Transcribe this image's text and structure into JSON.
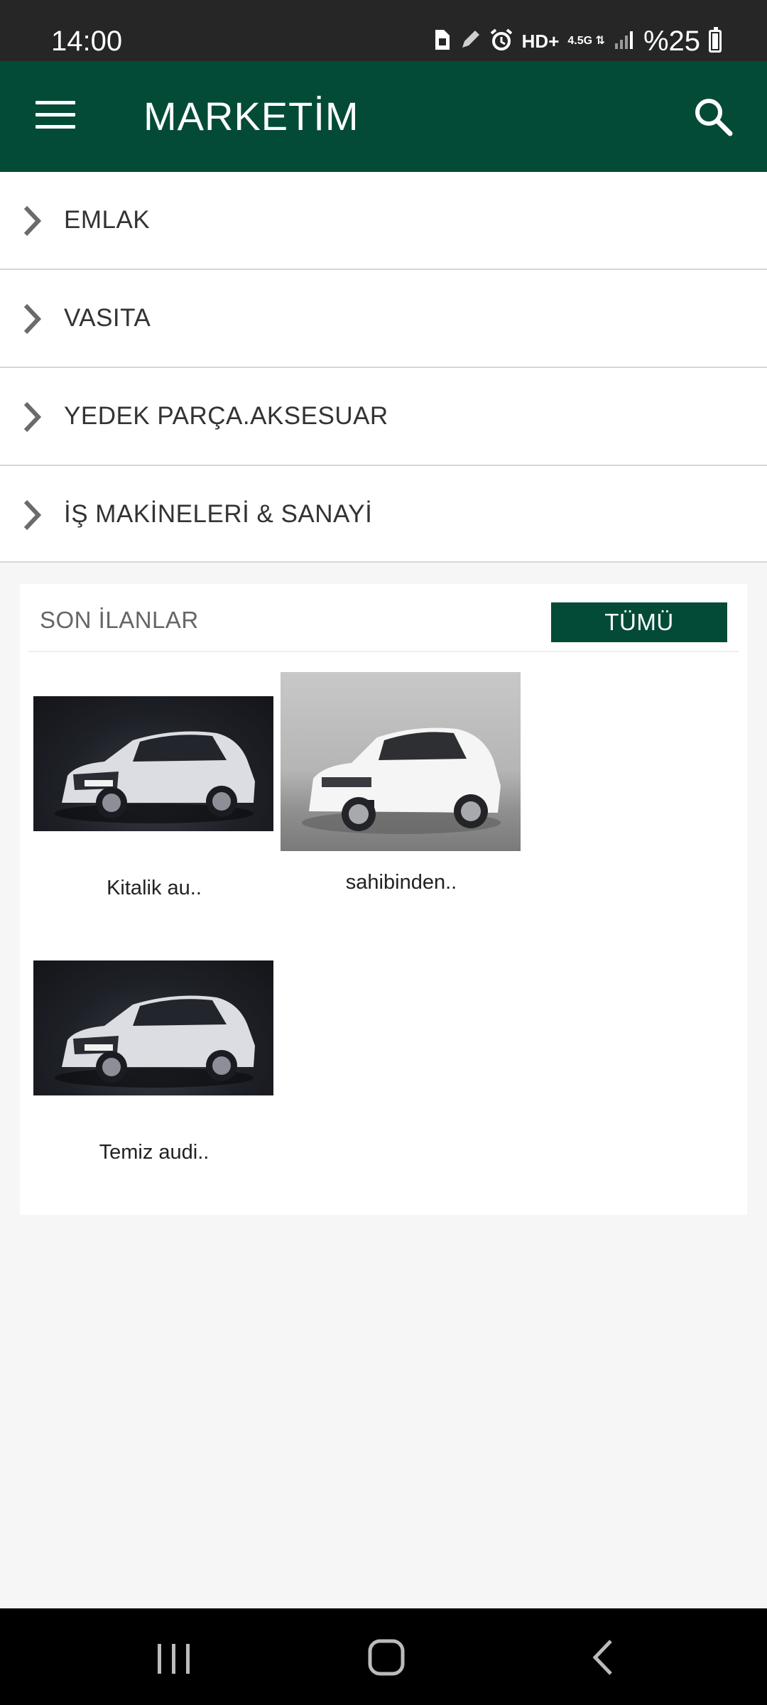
{
  "status_bar": {
    "time": "14:00",
    "network_type": "HD+",
    "network_gen": "4.5G",
    "battery_percent": "%25",
    "icons": [
      "sim-icon",
      "pencil-icon",
      "alarm-icon",
      "signal-icon",
      "battery-icon"
    ]
  },
  "app_bar": {
    "title": "MARKETİM",
    "menu_icon": "hamburger-menu-icon",
    "search_icon": "search-icon",
    "background_color": "#034b37"
  },
  "categories": [
    {
      "label": "EMLAK"
    },
    {
      "label": "VASITA"
    },
    {
      "label": "YEDEK PARÇA.AKSESUAR"
    },
    {
      "label": "İŞ MAKİNELERİ & SANAYİ"
    }
  ],
  "recent_listings": {
    "title": "SON İLANLAR",
    "all_button_label": "TÜMÜ",
    "items": [
      {
        "caption": "Kitalik au..",
        "image": "white-audi-hatchback-photo"
      },
      {
        "caption": "sahibinden..",
        "image": "white-volkswagen-golf-photo"
      },
      {
        "caption": "Temiz audi..",
        "image": "white-audi-hatchback-photo"
      }
    ]
  },
  "nav_bar": {
    "recents_icon": "recent-apps-icon",
    "home_icon": "home-icon",
    "back_icon": "back-icon"
  }
}
